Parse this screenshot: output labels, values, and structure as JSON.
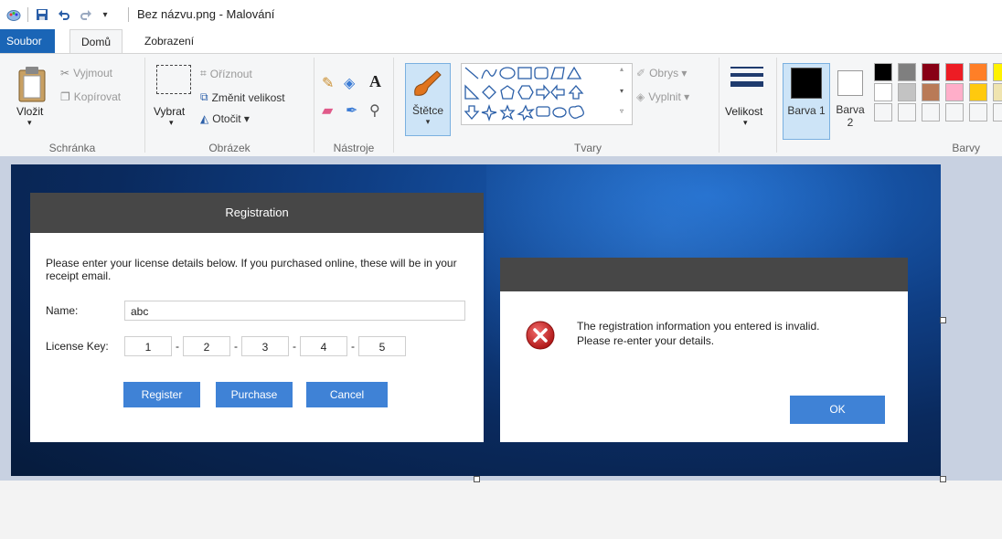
{
  "window": {
    "title": "Bez názvu.png - Malování"
  },
  "tabs": [
    {
      "label": "Soubor"
    },
    {
      "label": "Domů"
    },
    {
      "label": "Zobrazení"
    }
  ],
  "ribbon": {
    "clipboard": {
      "group": "Schránka",
      "paste": "Vložit",
      "cut": "Vyjmout",
      "copy": "Kopírovat"
    },
    "image": {
      "group": "Obrázek",
      "select": "Vybrat",
      "crop": "Oříznout",
      "resize": "Změnit velikost",
      "rotate": "Otočit ▾"
    },
    "tools": {
      "group": "Nástroje"
    },
    "brushes": {
      "label": "Štětce"
    },
    "shapes": {
      "group": "Tvary",
      "outline": "Obrys ▾",
      "fill": "Vyplnit ▾"
    },
    "size": {
      "label": "Velikost"
    },
    "colors": {
      "group": "Barvy",
      "color1": "Barva 1",
      "color2": "Barva 2",
      "palette_row1": [
        "#000000",
        "#7f7f7f",
        "#880015",
        "#ed1c24",
        "#ff7f27",
        "#fff200"
      ],
      "palette_row2": [
        "#ffffff",
        "#c3c3c3",
        "#b97a57",
        "#ffaec9",
        "#ffc90e",
        "#efe4b0"
      ]
    }
  },
  "registration": {
    "title": "Registration",
    "description": "Please enter your license details below. If you purchased online, these will be in your receipt email.",
    "name_label": "Name:",
    "name_value": "abc",
    "key_label": "License Key:",
    "key_parts": [
      "1",
      "2",
      "3",
      "4",
      "5"
    ],
    "register": "Register",
    "purchase": "Purchase",
    "cancel": "Cancel"
  },
  "error": {
    "line1": "The registration information you entered is invalid.",
    "line2": "Please re-enter your details.",
    "ok": "OK"
  },
  "colors": {
    "accent": "#3f82d6",
    "file_tab": "#1a65b6",
    "dialog_header": "#474747",
    "error_icon": "#d13438"
  }
}
